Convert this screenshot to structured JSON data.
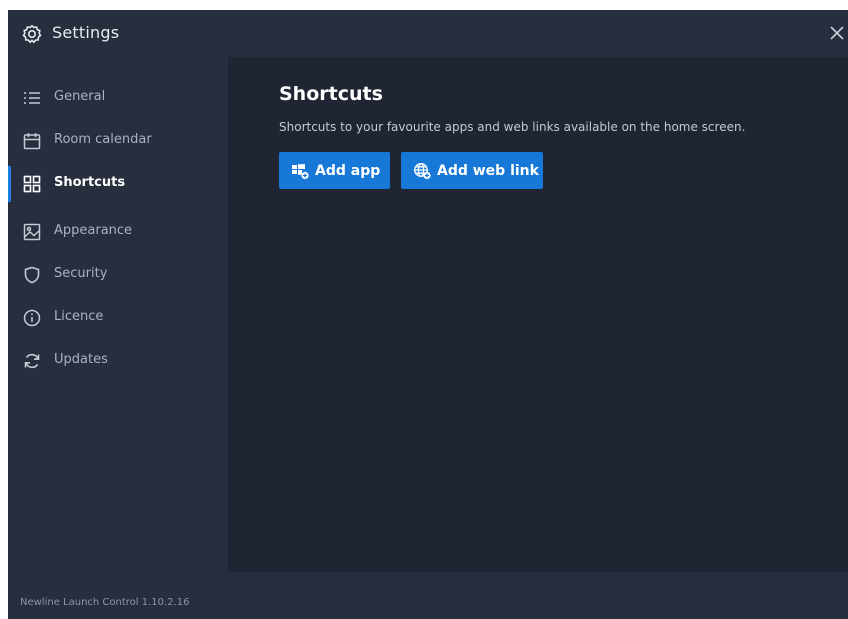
{
  "window": {
    "title": "Settings",
    "title_icon": "gear-icon",
    "close_icon": "close-icon"
  },
  "sidebar": {
    "items": [
      {
        "label": "General",
        "icon": "list-icon",
        "active": false
      },
      {
        "label": "Room calendar",
        "icon": "calendar-icon",
        "active": false
      },
      {
        "label": "Shortcuts",
        "icon": "grid-icon",
        "active": true
      },
      {
        "label": "Appearance",
        "icon": "image-icon",
        "active": false
      },
      {
        "label": "Security",
        "icon": "shield-icon",
        "active": false
      },
      {
        "label": "Licence",
        "icon": "info-icon",
        "active": false
      },
      {
        "label": "Updates",
        "icon": "refresh-icon",
        "active": false
      }
    ]
  },
  "main": {
    "title": "Shortcuts",
    "description": "Shortcuts to your favourite apps and web links available on the home screen.",
    "buttons": {
      "add_app": "Add app",
      "add_web_link": "Add web link"
    }
  },
  "footer": {
    "version": "Newline Launch Control 1.10.2.16"
  },
  "colors": {
    "background": "#1f2533",
    "panel": "#272e3d",
    "accent": "#1778d8",
    "text": "#ffffff",
    "muted_text": "#aab2c2"
  }
}
